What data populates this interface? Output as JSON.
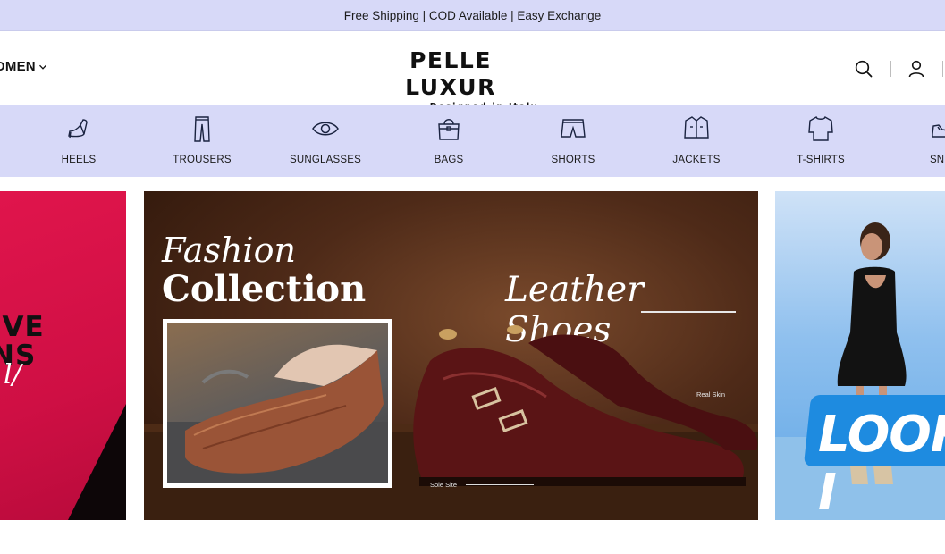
{
  "announcement": {
    "text": "Free Shipping | COD Available | Easy Exchange"
  },
  "header": {
    "nav_women_label": "OMEN",
    "logo_name": "PELLE LUXUR",
    "logo_tagline": "Designed in Italy",
    "search_icon": "search-icon",
    "account_icon": "user-icon"
  },
  "categories": [
    {
      "label": "HEELS",
      "icon": "heel-icon"
    },
    {
      "label": "TROUSERS",
      "icon": "trousers-icon"
    },
    {
      "label": "SUNGLASSES",
      "icon": "eye-icon"
    },
    {
      "label": "BAGS",
      "icon": "bag-icon"
    },
    {
      "label": "SHORTS",
      "icon": "shorts-icon"
    },
    {
      "label": "JACKETS",
      "icon": "jacket-icon"
    },
    {
      "label": "T-SHIRTS",
      "icon": "tshirt-icon"
    },
    {
      "label": "SNEA",
      "icon": "sneaker-icon"
    }
  ],
  "banners": {
    "left": {
      "line1": "IVE",
      "line2": "NS",
      "script": "l/"
    },
    "main": {
      "heading_italic": "Fashion",
      "heading_bold": "Collection",
      "title": "Leather Shoes",
      "annotation_1": "Real Skin",
      "annotation_2": "Sole Site"
    },
    "right": {
      "text": "LOOK I"
    }
  },
  "colors": {
    "accent_lavender": "#d7d9f8",
    "text_dark": "#111111",
    "banner_pink": "#d8124a",
    "banner_blue": "#1e8be0"
  }
}
